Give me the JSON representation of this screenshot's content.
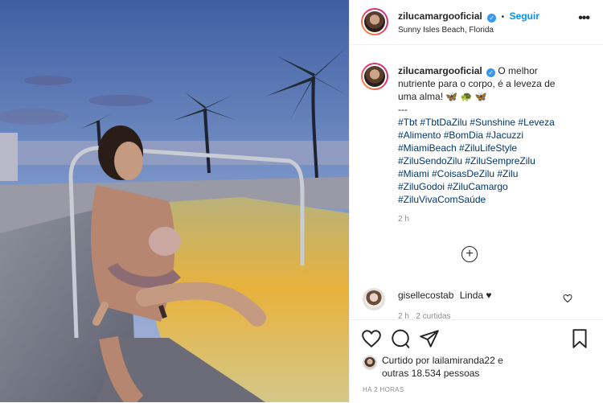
{
  "post": {
    "username": "zilucamargooficial",
    "verified_mark": "✓",
    "follow_separator": "•",
    "follow_label": "Seguir",
    "location": "Sunny Isles Beach, Florida",
    "more_label": "•••"
  },
  "caption": {
    "username": "zilucamargooficial",
    "line1": "O melhor",
    "line2": "nutriente para o corpo, é a leveza de",
    "line3": "uma alma! 🦋 🐢 🦋",
    "separator": "---",
    "hashtag_lines": [
      "#Tbt #TbtDaZilu #Sunshine #Leveza",
      "#Alimento #BomDia #Jacuzzi",
      "#MiamiBeach #ZiluLifeStyle",
      "#ZiluSendoZilu #ZiluSempreZilu",
      "#Miami #CoisasDeZilu #Zilu",
      "#ZiluGodoi #ZiluCamargo",
      "#ZiluVivaComSaúde"
    ],
    "time": "2 h"
  },
  "comments": [
    {
      "username": "gisellecostab",
      "text": "Linda ♥",
      "meta": "2 h   2 curtidas"
    }
  ],
  "likes": {
    "prefix": "Curtido por",
    "user": "lailamiranda22",
    "conj": "e",
    "others": "outras 18.534 pessoas"
  },
  "time_ago": "HÁ 2 HORAS",
  "colors": {
    "accent": "#0095f6",
    "hashtag": "#00376b",
    "verified": "#3897f0"
  }
}
